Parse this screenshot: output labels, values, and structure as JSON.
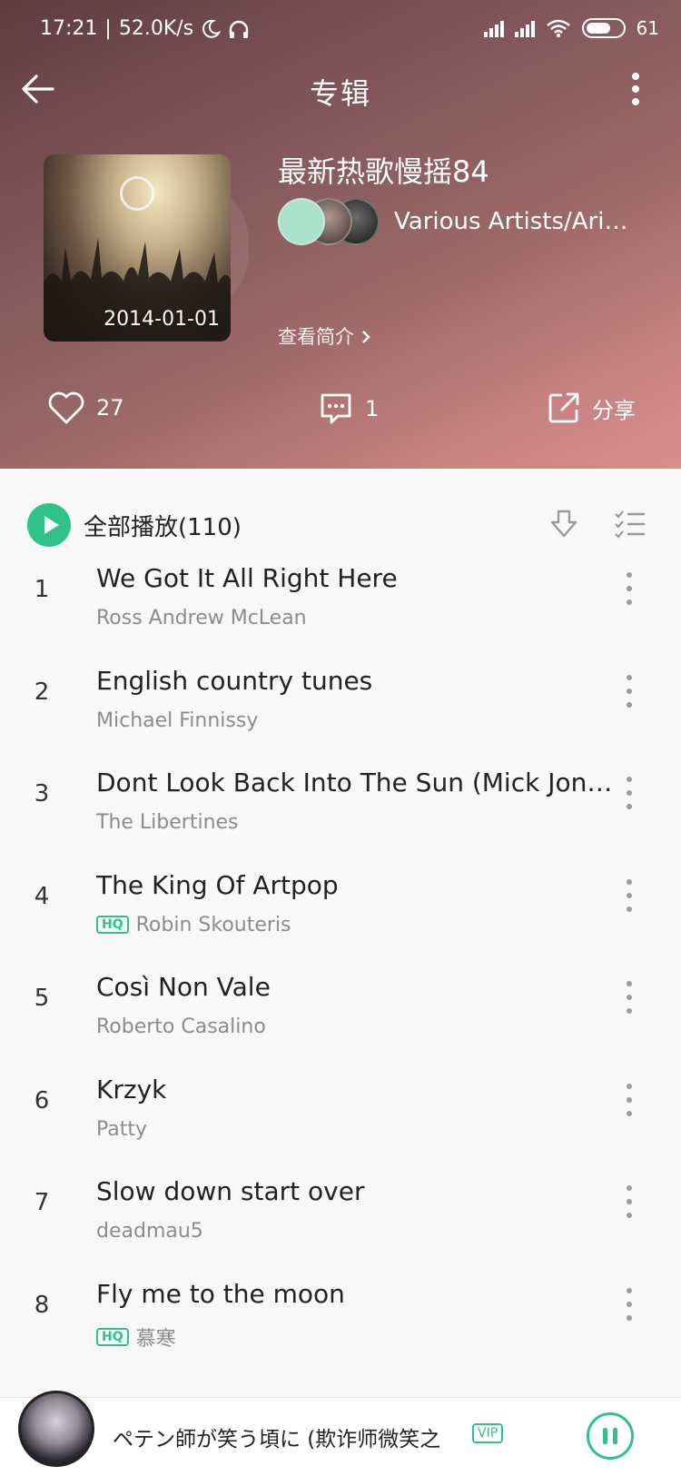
{
  "status_bar": {
    "time": "17:21",
    "net_speed": "52.0K/s",
    "battery": "61"
  },
  "nav": {
    "title": "专辑"
  },
  "album": {
    "title": "最新热歌慢摇84",
    "date": "2014-01-01",
    "artists": "Various Artists/Aria...",
    "intro_link": "查看简介",
    "likes": "27",
    "comments": "1",
    "share_label": "分享"
  },
  "playlist": {
    "play_all_label": "全部播放(110)",
    "songs": [
      {
        "num": "1",
        "title": "We Got It All Right Here",
        "artist": "Ross Andrew McLean",
        "hq": false
      },
      {
        "num": "2",
        "title": "English country tunes",
        "artist": "Michael Finnissy",
        "hq": false
      },
      {
        "num": "3",
        "title": "Dont Look Back Into The Sun (Mick Jones Version)",
        "artist": "The Libertines",
        "hq": false
      },
      {
        "num": "4",
        "title": "The King Of Artpop",
        "artist": "Robin Skouteris",
        "hq": true
      },
      {
        "num": "5",
        "title": "Così Non Vale",
        "artist": "Roberto Casalino",
        "hq": false
      },
      {
        "num": "6",
        "title": "Krzyk",
        "artist": "Patty",
        "hq": false
      },
      {
        "num": "7",
        "title": "Slow down start over",
        "artist": "deadmau5",
        "hq": false
      },
      {
        "num": "8",
        "title": "Fly me to the moon",
        "artist": "慕寒",
        "hq": true
      }
    ],
    "hq_label": "HQ"
  },
  "mini_player": {
    "title": "ペテン師が笑う頃に (欺诈师微笑之",
    "vip_label": "VIP"
  },
  "colors": {
    "accent": "#2fc38a",
    "header_start": "#5e3c42",
    "header_end": "#d88f8c"
  }
}
